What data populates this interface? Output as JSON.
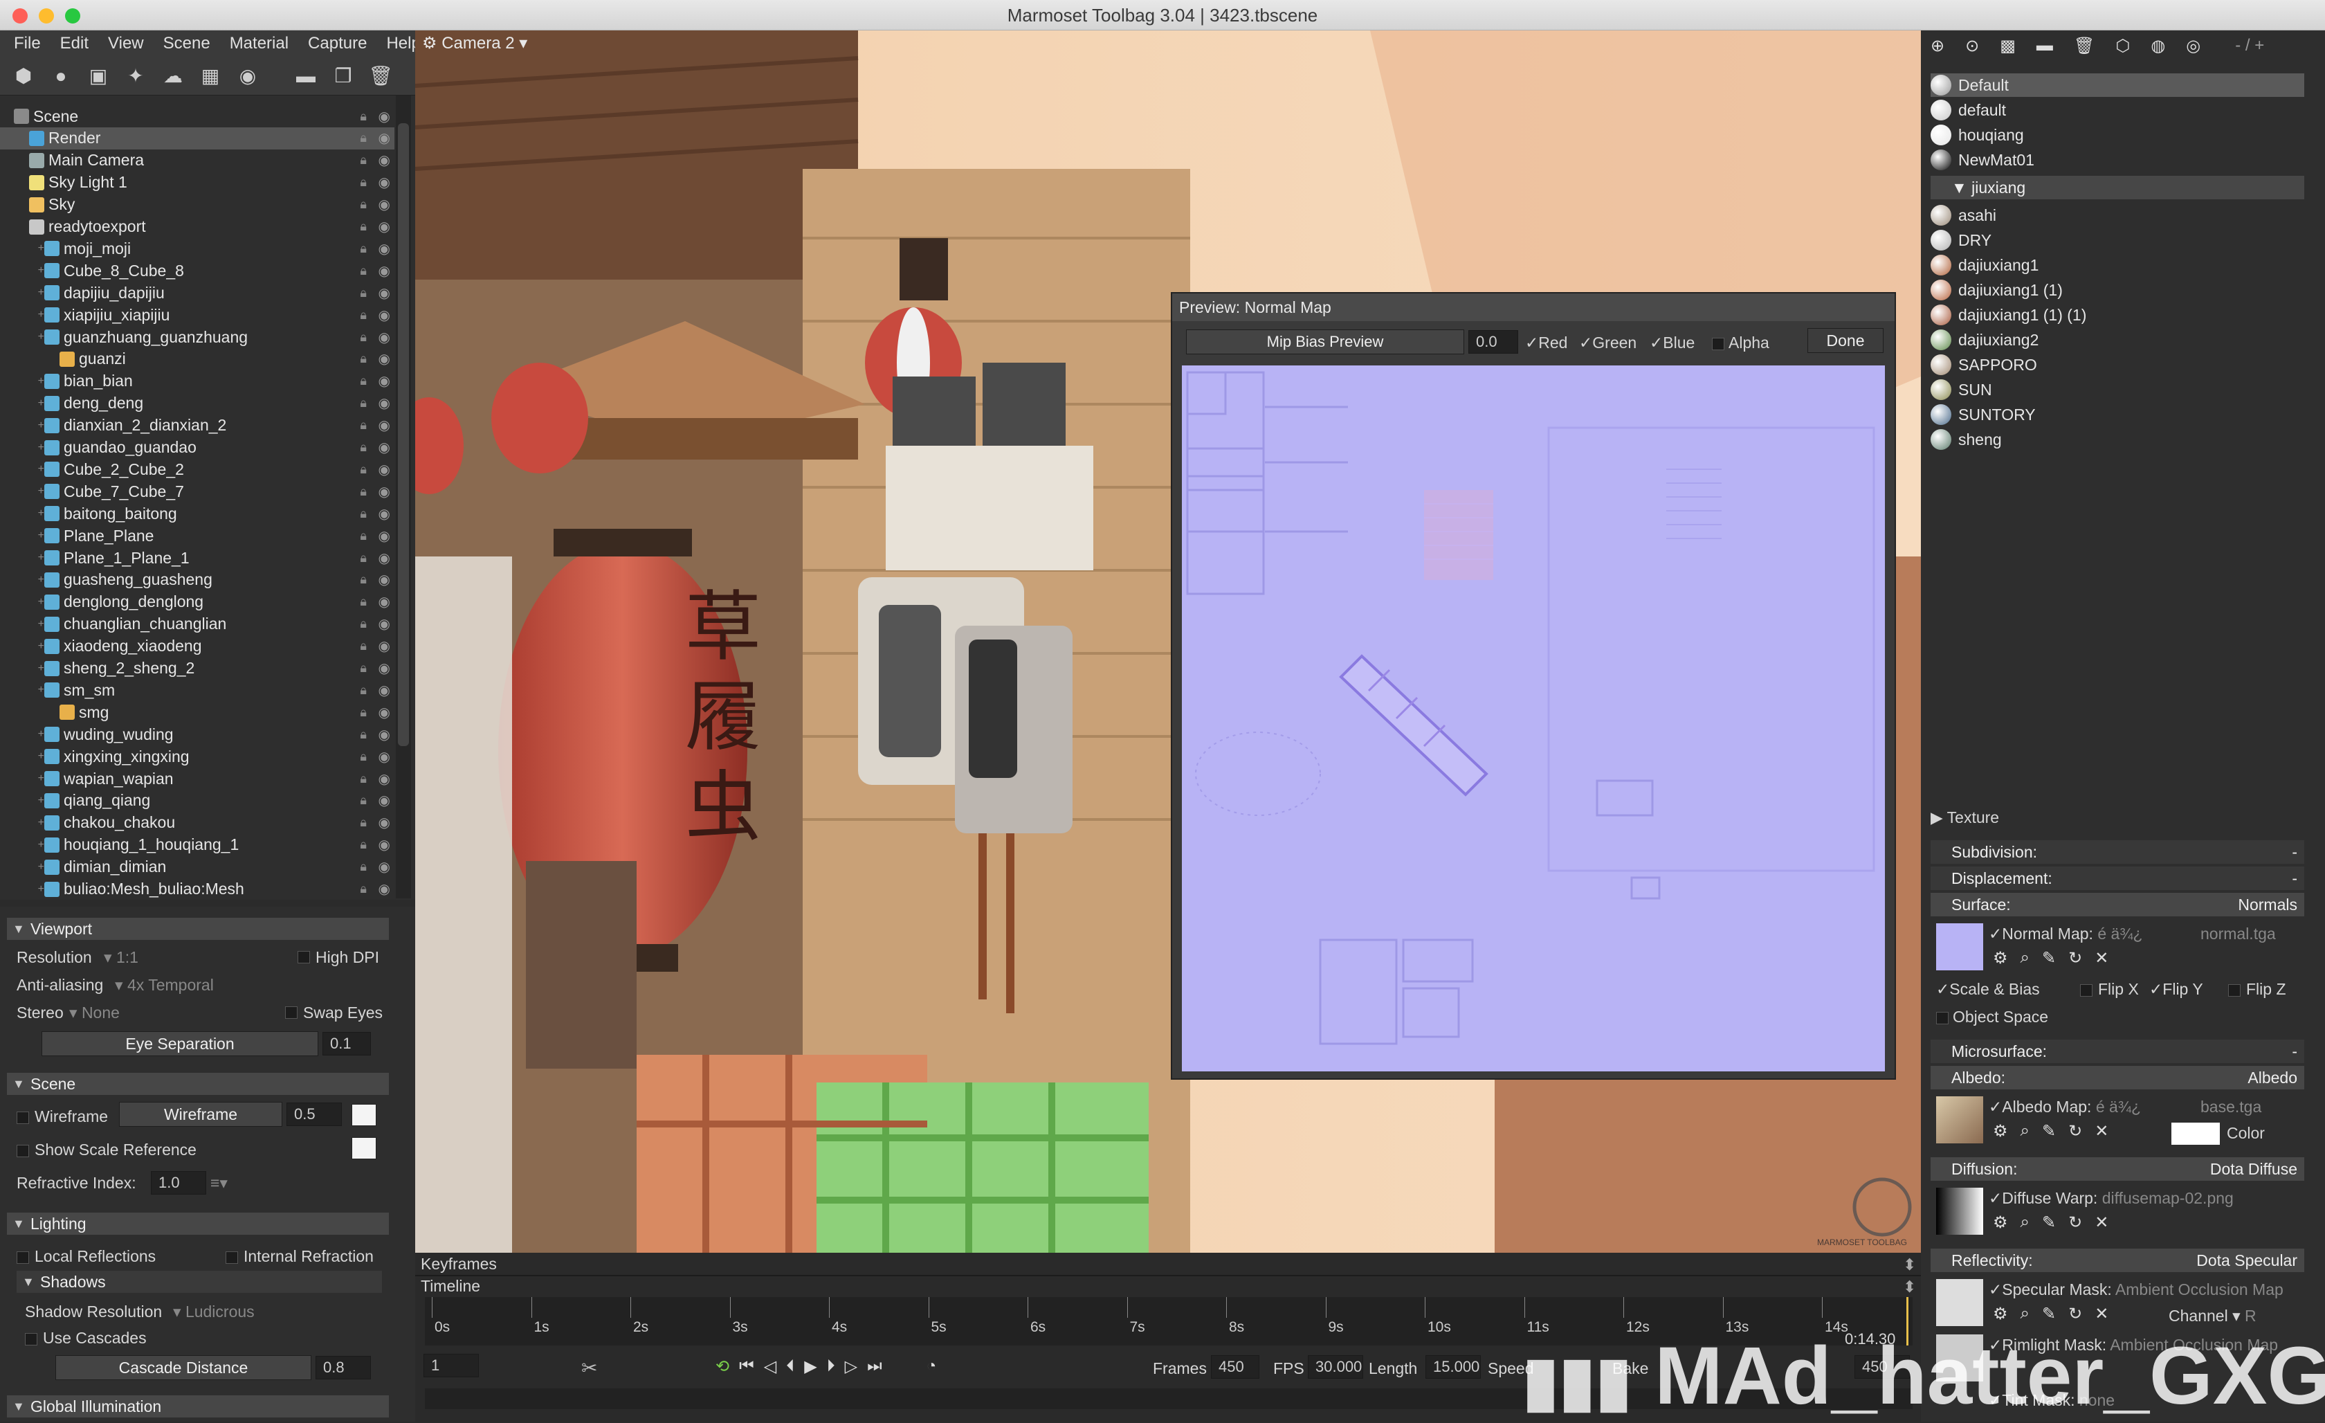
{
  "window": {
    "title": "Marmoset Toolbag 3.04  |  3423.tbscene"
  },
  "menu": [
    "File",
    "Edit",
    "View",
    "Scene",
    "Material",
    "Capture",
    "Help"
  ],
  "viewport": {
    "camera_label": "Camera 2",
    "brand": "MARMOSET TOOLBAG"
  },
  "outliner": {
    "items": [
      {
        "label": "Scene",
        "depth": 0,
        "icon": "scene"
      },
      {
        "label": "Render",
        "depth": 1,
        "icon": "render",
        "selected": true
      },
      {
        "label": "Main Camera",
        "depth": 1,
        "icon": "camera"
      },
      {
        "label": "Sky Light 1",
        "depth": 1,
        "icon": "light"
      },
      {
        "label": "Sky",
        "depth": 1,
        "icon": "sky"
      },
      {
        "label": "readytoexport",
        "depth": 1,
        "icon": "object"
      },
      {
        "label": "moji_moji",
        "depth": 2,
        "icon": "mesh"
      },
      {
        "label": "Cube_8_Cube_8",
        "depth": 2,
        "icon": "mesh"
      },
      {
        "label": "dapijiu_dapijiu",
        "depth": 2,
        "icon": "mesh"
      },
      {
        "label": "xiapijiu_xiapijiu",
        "depth": 2,
        "icon": "mesh"
      },
      {
        "label": "guanzhuang_guanzhuang",
        "depth": 2,
        "icon": "mesh"
      },
      {
        "label": "guanzi",
        "depth": 3,
        "icon": "submesh"
      },
      {
        "label": "bian_bian",
        "depth": 2,
        "icon": "mesh"
      },
      {
        "label": "deng_deng",
        "depth": 2,
        "icon": "mesh"
      },
      {
        "label": "dianxian_2_dianxian_2",
        "depth": 2,
        "icon": "mesh"
      },
      {
        "label": "guandao_guandao",
        "depth": 2,
        "icon": "mesh"
      },
      {
        "label": "Cube_2_Cube_2",
        "depth": 2,
        "icon": "mesh"
      },
      {
        "label": "Cube_7_Cube_7",
        "depth": 2,
        "icon": "mesh"
      },
      {
        "label": "baitong_baitong",
        "depth": 2,
        "icon": "mesh"
      },
      {
        "label": "Plane_Plane",
        "depth": 2,
        "icon": "mesh"
      },
      {
        "label": "Plane_1_Plane_1",
        "depth": 2,
        "icon": "mesh"
      },
      {
        "label": "guasheng_guasheng",
        "depth": 2,
        "icon": "mesh"
      },
      {
        "label": "denglong_denglong",
        "depth": 2,
        "icon": "mesh"
      },
      {
        "label": "chuanglian_chuanglian",
        "depth": 2,
        "icon": "mesh"
      },
      {
        "label": "xiaodeng_xiaodeng",
        "depth": 2,
        "icon": "mesh"
      },
      {
        "label": "sheng_2_sheng_2",
        "depth": 2,
        "icon": "mesh"
      },
      {
        "label": "sm_sm",
        "depth": 2,
        "icon": "mesh"
      },
      {
        "label": "smg",
        "depth": 3,
        "icon": "submesh"
      },
      {
        "label": "wuding_wuding",
        "depth": 2,
        "icon": "mesh"
      },
      {
        "label": "xingxing_xingxing",
        "depth": 2,
        "icon": "mesh"
      },
      {
        "label": "wapian_wapian",
        "depth": 2,
        "icon": "mesh"
      },
      {
        "label": "qiang_qiang",
        "depth": 2,
        "icon": "mesh"
      },
      {
        "label": "chakou_chakou",
        "depth": 2,
        "icon": "mesh"
      },
      {
        "label": "houqiang_1_houqiang_1",
        "depth": 2,
        "icon": "mesh"
      },
      {
        "label": "dimian_dimian",
        "depth": 2,
        "icon": "mesh"
      },
      {
        "label": "buliao:Mesh_buliao:Mesh",
        "depth": 2,
        "icon": "mesh"
      }
    ]
  },
  "viewport_panel": {
    "title": "Viewport",
    "resolution_label": "Resolution",
    "resolution_value": "1:1",
    "high_dpi": "High DPI",
    "aa_label": "Anti-aliasing",
    "aa_value": "4x Temporal",
    "stereo_label": "Stereo",
    "stereo_value": "None",
    "swap_eyes": "Swap Eyes",
    "eye_sep_label": "Eye Separation",
    "eye_sep_value": "0.1"
  },
  "scene_panel": {
    "title": "Scene",
    "wireframe": "Wireframe",
    "wireframe_slider": "Wireframe",
    "wireframe_value": "0.5",
    "show_scale": "Show Scale Reference",
    "refractive_label": "Refractive Index:",
    "refractive_value": "1.0"
  },
  "lighting_panel": {
    "title": "Lighting",
    "local_reflections": "Local Reflections",
    "internal_refraction": "Internal Refraction",
    "shadows_title": "Shadows",
    "shadow_res_label": "Shadow Resolution",
    "shadow_res_value": "Ludicrous",
    "use_cascades": "Use Cascades",
    "cascade_label": "Cascade Distance",
    "cascade_value": "0.8",
    "gi_title": "Global Illumination"
  },
  "preview": {
    "title": "Preview: Normal Map",
    "mip_label": "Mip Bias Preview",
    "mip_value": "0.0",
    "red": "Red",
    "green": "Green",
    "blue": "Blue",
    "alpha": "Alpha",
    "done": "Done"
  },
  "materials": {
    "top": [
      {
        "label": "Default",
        "color": "#9a9a9a",
        "selected": true
      },
      {
        "label": "default",
        "color": "#c8c8c8"
      },
      {
        "label": "houqiang",
        "color": "#e6e6e6"
      },
      {
        "label": "NewMat01",
        "color": "#0a0a0a"
      }
    ],
    "group": "jiuxiang",
    "group_items": [
      {
        "label": "asahi",
        "color": "#9a8a78"
      },
      {
        "label": "DRY",
        "color": "#b0b0b0"
      },
      {
        "label": "dajiuxiang1",
        "color": "#b0623a"
      },
      {
        "label": "dajiuxiang1 (1)",
        "color": "#b8643e"
      },
      {
        "label": "dajiuxiang1 (1) (1)",
        "color": "#a85a3c"
      },
      {
        "label": "dajiuxiang2",
        "color": "#5e8a4a"
      },
      {
        "label": "SAPPORO",
        "color": "#a08870"
      },
      {
        "label": "SUN",
        "color": "#8a8a50"
      },
      {
        "label": "SUNTORY",
        "color": "#4a6a8a"
      },
      {
        "label": "sheng",
        "color": "#5a7a6a"
      }
    ]
  },
  "material_props": {
    "texture": "Texture",
    "subdivision": "Subdivision:",
    "subdivision_value": "-",
    "displacement": "Displacement:",
    "displacement_value": "-",
    "surface": "Surface:",
    "surface_value": "Normals",
    "normal_map_label": "Normal Map:",
    "normal_map_garble": "é   ä¾¿",
    "normal_map_file": "normal.tga",
    "scale_bias": "Scale & Bias",
    "flip_x": "Flip X",
    "flip_y": "Flip Y",
    "flip_z": "Flip Z",
    "object_space": "Object Space",
    "microsurface": "Microsurface:",
    "microsurface_value": "-",
    "albedo": "Albedo:",
    "albedo_value": "Albedo",
    "albedo_map_label": "Albedo Map:",
    "albedo_map_garble": "é   ä¾¿",
    "albedo_map_file": "base.tga",
    "color_label": "Color",
    "diffusion": "Diffusion:",
    "diffusion_value": "Dota Diffuse",
    "diffuse_warp": "Diffuse Warp:",
    "diffuse_warp_file": "diffusemap-02.png",
    "reflectivity": "Reflectivity:",
    "reflectivity_value": "Dota Specular",
    "spec_mask": "Specular Mask:",
    "spec_mask_value": "Ambient Occlusion Map",
    "channel_label": "Channel",
    "channel_value": "R",
    "rimlight_mask": "Rimlight Mask:",
    "rimlight_value": "Ambient Occlusion Map",
    "tint_mask": "Tint Mask:",
    "tint_value": "none"
  },
  "timeline": {
    "keyframes": "Keyframes",
    "timeline": "Timeline",
    "ticks": [
      "0s",
      "1s",
      "2s",
      "3s",
      "4s",
      "5s",
      "6s",
      "7s",
      "8s",
      "9s",
      "10s",
      "11s",
      "12s",
      "13s",
      "14s"
    ],
    "time_display": "0:14.30",
    "frame_value": "1",
    "frames_label": "Frames",
    "frames_value": "450",
    "fps_label": "FPS",
    "fps_value": "30.000",
    "length_label": "Length",
    "length_value": "15.000",
    "speed_label": "Speed",
    "bake_label": "Bake",
    "end_value": "450"
  },
  "watermark": {
    "text": "MAd_hatter_GXG"
  },
  "colors": {
    "accent_selected": "#555555",
    "normal_map": "#b8b3f5"
  }
}
